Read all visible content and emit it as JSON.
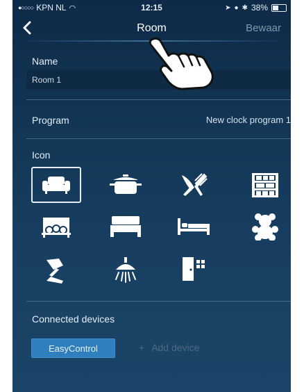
{
  "status_bar": {
    "carrier": "KPN NL",
    "time": "12:15",
    "battery": "38%",
    "battery_level": 0.38
  },
  "nav": {
    "back_icon": "chevron-left-icon",
    "title": "Room",
    "save": "Bewaar"
  },
  "name_section": {
    "label": "Name",
    "value": "Room 1"
  },
  "program": {
    "label": "Program",
    "value": "New clock program 1"
  },
  "icon_section": {
    "label": "Icon",
    "icons": [
      "sofa-icon",
      "pot-icon",
      "cutlery-icon",
      "shelf-icon",
      "family-icon",
      "double-bed-icon",
      "single-bed-icon",
      "teddy-bear-icon",
      "desk-lamp-icon",
      "shower-icon",
      "door-icon"
    ],
    "selected": "sofa-icon"
  },
  "connected": {
    "label": "Connected devices",
    "device": "EasyControl",
    "add_label": "Add device",
    "add_icon": "plus-icon"
  },
  "overlay": {
    "icon": "pointing-hand-icon"
  },
  "colors": {
    "accent": "#2f7fbf",
    "background": "#133656",
    "muted": "#4d6a84"
  }
}
